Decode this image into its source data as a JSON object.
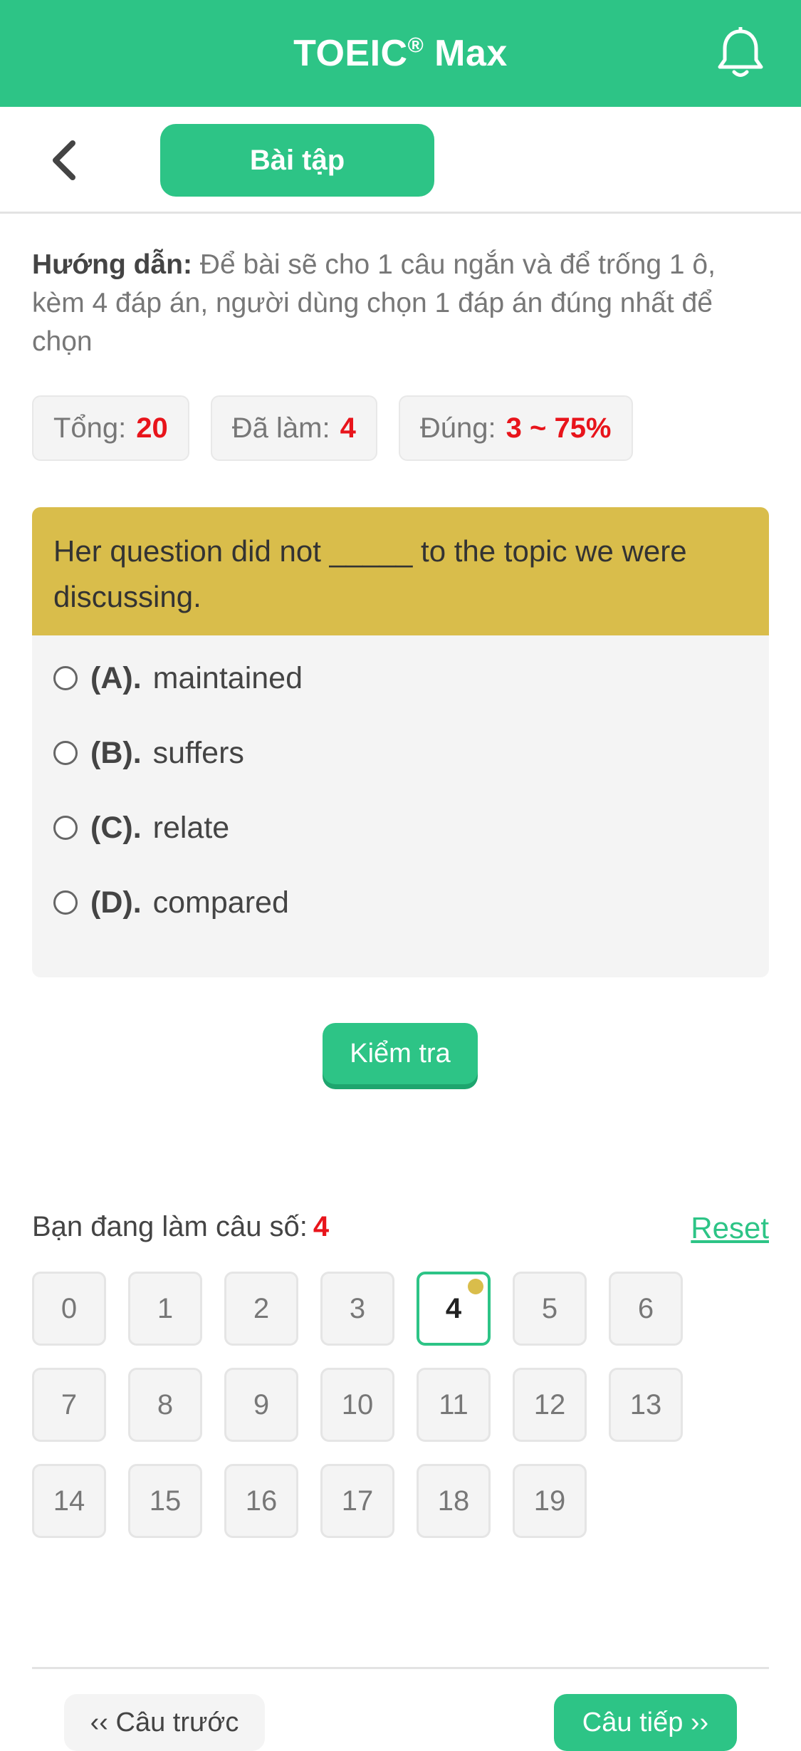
{
  "header": {
    "title": "TOEIC",
    "title_mark": "®",
    "title_suffix": " Max",
    "bell_icon": "bell-icon"
  },
  "subheader": {
    "back_icon": "chevron-left-icon",
    "tab_label": "Bài tập"
  },
  "instructions": {
    "label": "Hướng dẫn:",
    "text": " Để bài sẽ cho 1 câu ngắn và để trống 1 ô, kèm 4 đáp án, người dùng chọn 1 đáp án đúng nhất để chọn"
  },
  "stats": {
    "total_label": "Tổng:",
    "total_value": "20",
    "done_label": "Đã làm:",
    "done_value": "4",
    "correct_label": "Đúng:",
    "correct_value": "3 ~ 75%"
  },
  "question": {
    "text": "Her question did not _____ to the topic we were discussing.",
    "options": [
      {
        "letter": "(A).",
        "text": "maintained"
      },
      {
        "letter": "(B).",
        "text": "suffers"
      },
      {
        "letter": "(C).",
        "text": "relate"
      },
      {
        "letter": "(D).",
        "text": "compared"
      }
    ]
  },
  "check_button": "Kiểm tra",
  "progress": {
    "label": "Bạn đang làm câu số:",
    "current": "4",
    "reset": "Reset"
  },
  "question_numbers": [
    "0",
    "1",
    "2",
    "3",
    "4",
    "5",
    "6",
    "7",
    "8",
    "9",
    "10",
    "11",
    "12",
    "13",
    "14",
    "15",
    "16",
    "17",
    "18",
    "19"
  ],
  "navigation": {
    "prev": "‹‹ Câu trước",
    "next": "Câu tiếp ››"
  },
  "colors": {
    "accent": "#2dc486",
    "question_header": "#d9bd4b",
    "highlight_value": "#e8141b"
  }
}
